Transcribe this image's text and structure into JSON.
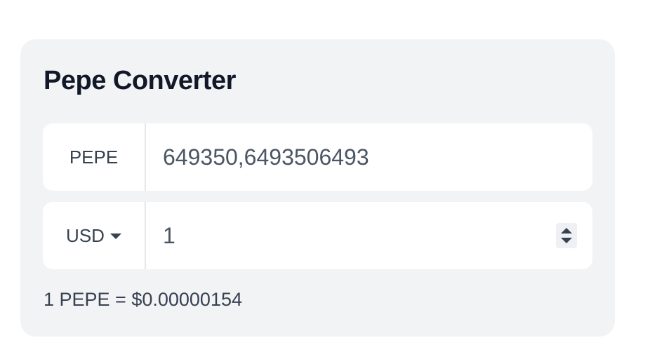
{
  "converter": {
    "title": "Pepe Converter",
    "from": {
      "currency": "PEPE",
      "value": "649350,6493506493"
    },
    "to": {
      "currency": "USD",
      "value": "1"
    },
    "rate_text": "1 PEPE = $0.00000154"
  },
  "icons": {
    "currency_dropdown": "caret-down-icon",
    "stepper": "number-stepper-icon"
  },
  "colors": {
    "card_bg": "#f2f3f5",
    "title": "#111827",
    "text": "#374151",
    "value_text": "#4b5563"
  }
}
